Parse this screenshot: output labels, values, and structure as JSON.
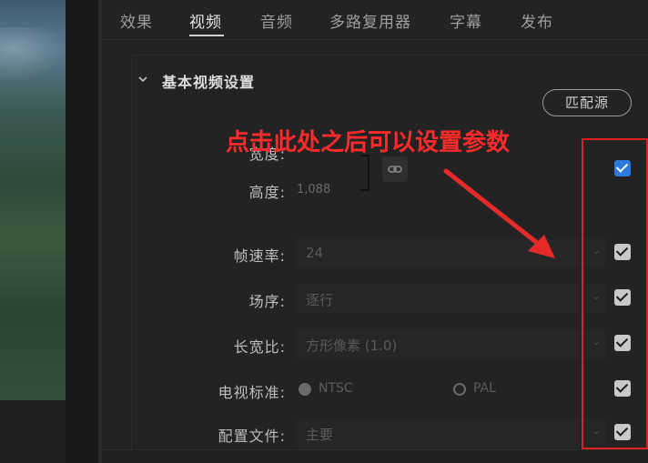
{
  "tabs": [
    {
      "label": "效果",
      "active": false
    },
    {
      "label": "视频",
      "active": true
    },
    {
      "label": "音频",
      "active": false
    },
    {
      "label": "多路复用器",
      "active": false
    },
    {
      "label": "字幕",
      "active": false
    },
    {
      "label": "发布",
      "active": false
    }
  ],
  "section": {
    "title": "基本视频设置",
    "match_button": "匹配源"
  },
  "fields": {
    "width_label": "宽度:",
    "height_label": "高度:",
    "height_value": "1,088",
    "frame_rate_label": "帧速率:",
    "frame_rate_value": "24",
    "field_order_label": "场序:",
    "field_order_value": "逐行",
    "aspect_label": "长宽比:",
    "aspect_value": "方形像素 (1.0)",
    "tv_standard_label": "电视标准:",
    "tv_ntsc": "NTSC",
    "tv_pal": "PAL",
    "profile_label": "配置文件:",
    "profile_value": "主要"
  },
  "annotation": {
    "text": "点击此处之后可以设置参数",
    "color": "#ff2a2a"
  },
  "colors": {
    "checkbox_active": "#2c7bd8",
    "checkbox_inactive": "#c8c8c8",
    "highlight_box": "#e02020"
  },
  "icons": [
    "chevron-down-icon",
    "link-icon",
    "dropdown-arrow-icon",
    "checkbox-icon",
    "radio-icon"
  ]
}
